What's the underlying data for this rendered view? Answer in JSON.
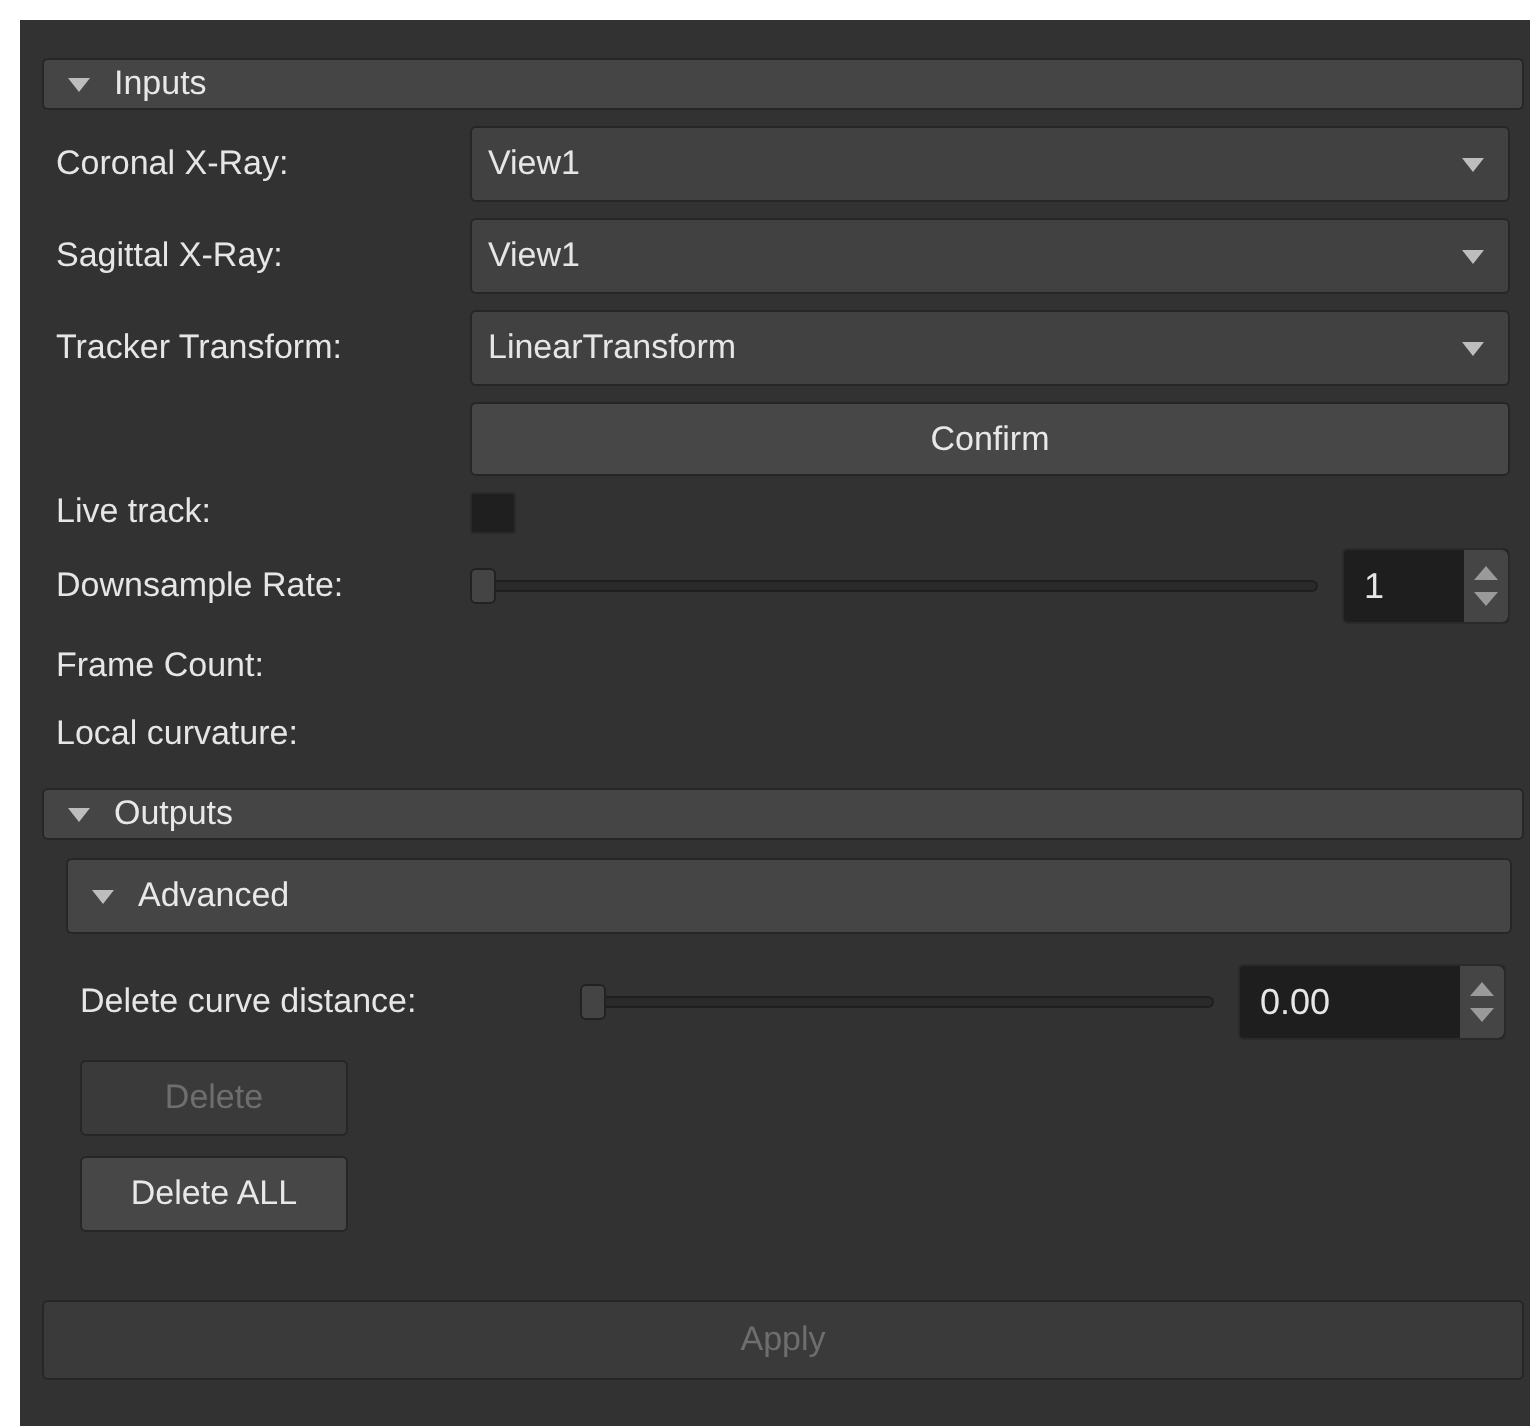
{
  "inputs": {
    "title": "Inputs",
    "expanded": true,
    "selectors": [
      {
        "label": "Coronal X-Ray:",
        "value": "View1"
      },
      {
        "label": "Sagittal X-Ray:",
        "value": "View1"
      },
      {
        "label": "Tracker Transform:",
        "value": "LinearTransform"
      }
    ],
    "confirm_button": {
      "label": "Confirm",
      "disabled": false
    },
    "live_track": {
      "label": "Live track:",
      "checked": false
    },
    "downsample_rate": {
      "label": "Downsample Rate:",
      "level": 0,
      "value": "1"
    },
    "info_labels": [
      "Frame Count:",
      "Local curvature:"
    ]
  },
  "outputs": {
    "title": "Outputs",
    "expanded": true,
    "advanced": {
      "title": "Advanced",
      "expanded": true,
      "delete_curve_distance": {
        "label": "Delete curve distance:",
        "level": 0,
        "value": "0.00"
      },
      "buttons": [
        {
          "label": "Delete",
          "disabled": true
        },
        {
          "label": "Delete ALL",
          "disabled": false
        }
      ]
    }
  },
  "apply_button": {
    "label": "Apply",
    "disabled": true
  }
}
